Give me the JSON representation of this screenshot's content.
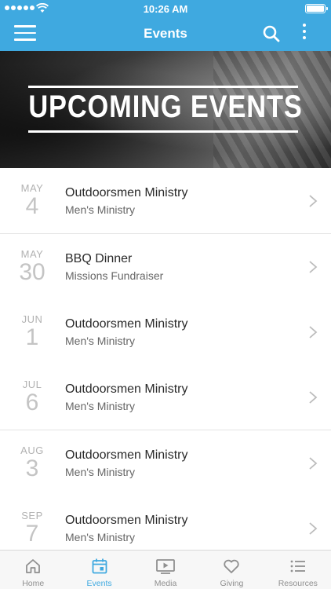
{
  "status_bar": {
    "time": "10:26 AM",
    "signal_icon": "signal-dots-icon",
    "wifi_icon": "wifi-icon",
    "battery_icon": "battery-icon"
  },
  "nav": {
    "title": "Events",
    "menu_icon": "hamburger-menu-icon",
    "search_icon": "search-icon",
    "more_icon": "more-vertical-icon"
  },
  "banner": {
    "text": "UPCOMING EVENTS"
  },
  "events": [
    {
      "month": "MAY",
      "day": "4",
      "title": "Outdoorsmen Ministry",
      "subtitle": "Men's Ministry"
    },
    {
      "month": "MAY",
      "day": "30",
      "title": "BBQ Dinner",
      "subtitle": "Missions Fundraiser"
    },
    {
      "month": "JUN",
      "day": "1",
      "title": "Outdoorsmen Ministry",
      "subtitle": "Men's Ministry"
    },
    {
      "month": "JUL",
      "day": "6",
      "title": "Outdoorsmen Ministry",
      "subtitle": "Men's Ministry"
    },
    {
      "month": "AUG",
      "day": "3",
      "title": "Outdoorsmen Ministry",
      "subtitle": "Men's Ministry"
    },
    {
      "month": "SEP",
      "day": "7",
      "title": "Outdoorsmen Ministry",
      "subtitle": "Men's Ministry"
    }
  ],
  "tabs": [
    {
      "label": "Home",
      "icon": "home-icon",
      "active": false
    },
    {
      "label": "Events",
      "icon": "calendar-icon",
      "active": true
    },
    {
      "label": "Media",
      "icon": "play-video-icon",
      "active": false
    },
    {
      "label": "Giving",
      "icon": "heart-icon",
      "active": false
    },
    {
      "label": "Resources",
      "icon": "list-icon",
      "active": false
    }
  ],
  "colors": {
    "accent": "#3fa9e0",
    "tab_inactive": "#8f8f8f",
    "date_text": "#b2b2b2"
  }
}
